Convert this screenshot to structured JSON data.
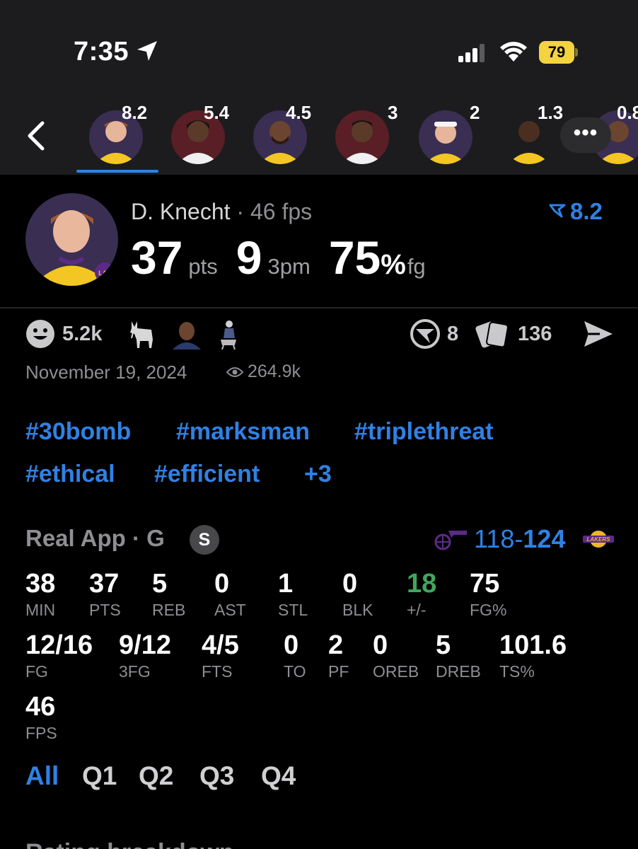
{
  "status_bar": {
    "time": "7:35",
    "battery": "79"
  },
  "player_strip": {
    "players": [
      {
        "name": "player-knecht",
        "score": "8.2",
        "active": true
      },
      {
        "name": "player-2",
        "score": "5.4"
      },
      {
        "name": "player-3",
        "score": "4.5"
      },
      {
        "name": "player-4",
        "score": "3"
      },
      {
        "name": "player-5",
        "score": "2"
      },
      {
        "name": "player-6",
        "score": "1.3"
      },
      {
        "name": "player-7",
        "score": "0.8"
      }
    ],
    "more_label": "•••"
  },
  "header": {
    "name": "D. Knecht",
    "fps_text": " · 46 fps",
    "rating": "8.2",
    "pts": "37",
    "pts_unit": "pts",
    "threes": "9",
    "threes_unit": "3pm",
    "fg": "75",
    "fg_pct_sign": "%",
    "fg_unit": "fg"
  },
  "reactions": {
    "likes": "5.2k",
    "comments_icon_count": "8",
    "cards_count": "136"
  },
  "meta": {
    "date": "November 19, 2024",
    "views": "264.9k"
  },
  "hashtags": [
    "#30bomb",
    "#marksman",
    "#triplethreat",
    "#ethical",
    "#efficient",
    "+3"
  ],
  "game": {
    "source": "Real App · G",
    "badge": "S",
    "away_score": "118",
    "sep": "-",
    "home_score": "124",
    "colors": {
      "accent": "#2f81e4",
      "positive": "#3fa85b",
      "jazz": "#5b2b87",
      "lakers_gold": "#f0b429"
    }
  },
  "stats_row1": [
    {
      "value": "38",
      "label": "MIN"
    },
    {
      "value": "37",
      "label": "PTS"
    },
    {
      "value": "5",
      "label": "REB"
    },
    {
      "value": "0",
      "label": "AST"
    },
    {
      "value": "1",
      "label": "STL"
    },
    {
      "value": "0",
      "label": "BLK"
    },
    {
      "value": "18",
      "label": "+/-"
    },
    {
      "value": "75",
      "label": "FG%"
    }
  ],
  "stats_row2": [
    {
      "value": "12/16",
      "label": "FG"
    },
    {
      "value": "9/12",
      "label": "3FG"
    },
    {
      "value": "4/5",
      "label": "FTS"
    },
    {
      "value": "0",
      "label": "TO"
    },
    {
      "value": "2",
      "label": "PF"
    },
    {
      "value": "0",
      "label": "OREB"
    },
    {
      "value": "5",
      "label": "DREB"
    },
    {
      "value": "101.6",
      "label": "TS%"
    }
  ],
  "stats_row3": [
    {
      "value": "46",
      "label": "FPS"
    }
  ],
  "quarter_tabs": [
    "All",
    "Q1",
    "Q2",
    "Q3",
    "Q4"
  ],
  "next_section": "Rating breakdown"
}
